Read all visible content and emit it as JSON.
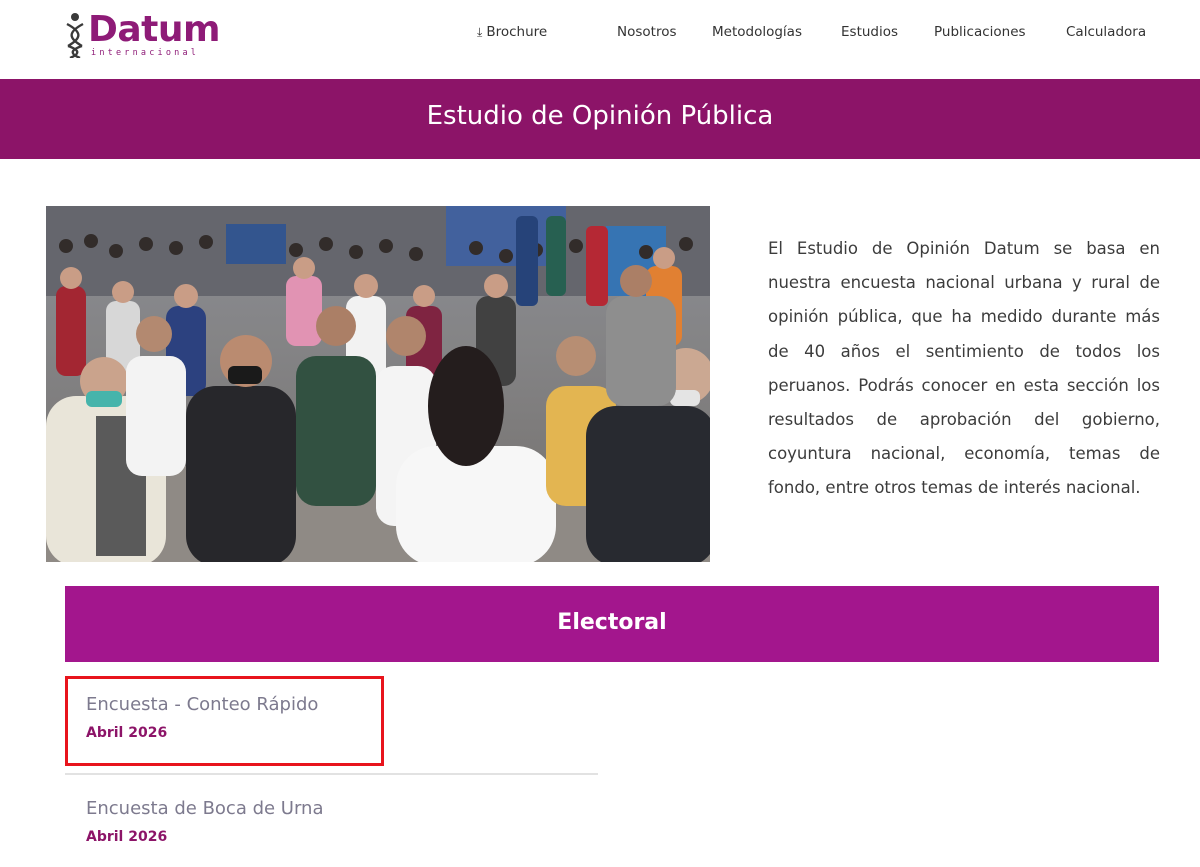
{
  "brand": {
    "name": "Datum",
    "tagline": "internacional",
    "color": "#8e1b77"
  },
  "nav": {
    "items": [
      {
        "label": "Brochure",
        "icon": "download-icon"
      },
      {
        "label": "Nosotros"
      },
      {
        "label": "Metodologías"
      },
      {
        "label": "Estudios"
      },
      {
        "label": "Publicaciones"
      },
      {
        "label": "Calculadora"
      }
    ]
  },
  "banner": {
    "title": "Estudio de Opinión Pública",
    "color": "#8c1468"
  },
  "intro": {
    "text": "El Estudio de Opinión Datum se basa en nuestra encuesta nacional urbana y rural de opinión pública, que ha medido durante más de 40 años el sentimiento de todos los peruanos. Podrás conocer en esta sección los resultados de aprobación del gobierno, coyuntura nacional, economía, temas de fondo, entre otros temas de interés nacional."
  },
  "section": {
    "title": "Electoral",
    "color": "#a3168d"
  },
  "studies": [
    {
      "title": "Encuesta - Conteo Rápido",
      "date": "Abril 2026"
    },
    {
      "title": "Encuesta de Boca de Urna",
      "date": "Abril 2026"
    }
  ]
}
